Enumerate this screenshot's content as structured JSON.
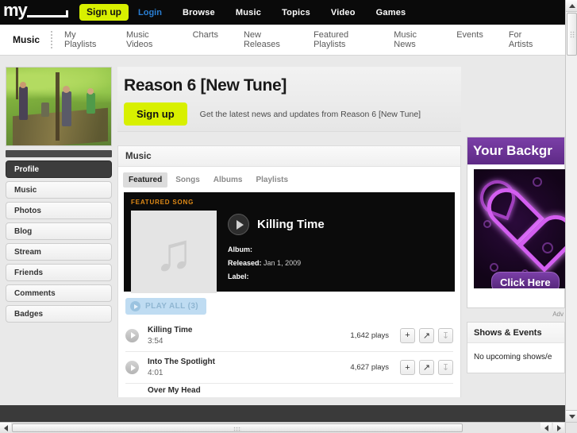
{
  "topnav": {
    "logo_text": "my",
    "signup_label": "Sign up",
    "login_label": "Login",
    "links": [
      "Browse",
      "Music",
      "Topics",
      "Video",
      "Games"
    ]
  },
  "subnav": {
    "primary": "Music",
    "items": [
      "My Playlists",
      "Music Videos",
      "Charts",
      "New Releases",
      "Featured Playlists",
      "Music News",
      "Events",
      "For Artists"
    ]
  },
  "profile": {
    "title": "Reason 6 [New Tune]",
    "signup_label": "Sign up",
    "subtitle": "Get the latest news and updates from Reason 6 [New Tune]"
  },
  "sidebar": {
    "items": [
      {
        "label": "Profile",
        "active": true
      },
      {
        "label": "Music",
        "active": false
      },
      {
        "label": "Photos",
        "active": false
      },
      {
        "label": "Blog",
        "active": false
      },
      {
        "label": "Stream",
        "active": false
      },
      {
        "label": "Friends",
        "active": false
      },
      {
        "label": "Comments",
        "active": false
      },
      {
        "label": "Badges",
        "active": false
      }
    ]
  },
  "music": {
    "heading": "Music",
    "tabs": [
      {
        "label": "Featured",
        "active": true
      },
      {
        "label": "Songs",
        "active": false
      },
      {
        "label": "Albums",
        "active": false
      },
      {
        "label": "Playlists",
        "active": false
      }
    ],
    "featured": {
      "label": "FEATURED SONG",
      "title": "Killing Time",
      "album_label": "Album:",
      "album_value": "",
      "released_label": "Released:",
      "released_value": "Jan 1, 2009",
      "label_label": "Label:",
      "label_value": ""
    },
    "play_all_label": "PLAY ALL (3)",
    "tracks": [
      {
        "name": "Killing Time",
        "duration": "3:54",
        "plays": "1,642 plays"
      },
      {
        "name": "Into The Spotlight",
        "duration": "4:01",
        "plays": "4,627 plays"
      },
      {
        "name": "Over My Head",
        "duration": "",
        "plays": ""
      }
    ],
    "track_buttons": {
      "add": "+",
      "share": "share-icon",
      "download": "download-icon"
    }
  },
  "ad": {
    "headline": "Your Backgr",
    "cta": "Click Here",
    "disclosure": "Adv"
  },
  "events": {
    "heading": "Shows & Events",
    "body": "No upcoming shows/e"
  },
  "colors": {
    "accent_yellow": "#d8f000",
    "link_blue": "#2a7fd4",
    "featured_orange": "#e08a16",
    "ad_purple": "#7b3fa8",
    "play_all_blue": "#bfdcf2"
  }
}
